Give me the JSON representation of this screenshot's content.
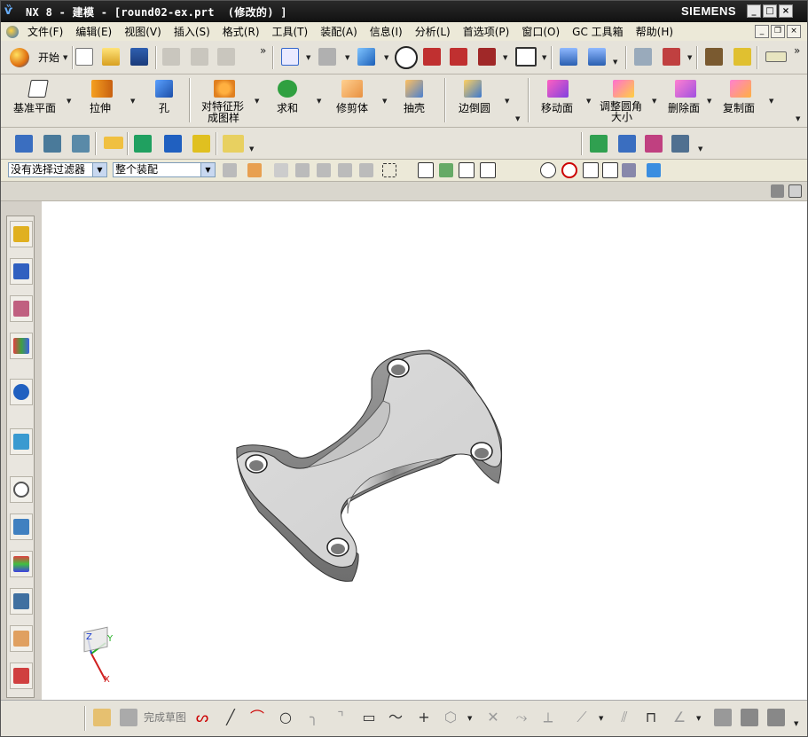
{
  "titlebar": {
    "text": "NX 8 - 建模 - [round02-ex.prt  (修改的) ]",
    "brand": "SIEMENS",
    "minimize": "_",
    "restore": "□",
    "close": "×"
  },
  "menubar": {
    "items": [
      "文件(F)",
      "编辑(E)",
      "视图(V)",
      "插入(S)",
      "格式(R)",
      "工具(T)",
      "装配(A)",
      "信息(I)",
      "分析(L)",
      "首选项(P)",
      "窗口(O)",
      "GC 工具箱",
      "帮助(H)"
    ]
  },
  "toolbar1": {
    "start_label": "开始",
    "overflow": "»"
  },
  "toolbar2": {
    "buttons": [
      {
        "label": "基准平面",
        "icon": "datum-plane-icon"
      },
      {
        "label": "拉伸",
        "icon": "extrude-icon"
      },
      {
        "label": "孔",
        "icon": "hole-icon"
      },
      {
        "label": "对特征形成图样",
        "line1": "对特征形",
        "line2": "成图样",
        "icon": "pattern-feature-icon"
      },
      {
        "label": "求和",
        "icon": "unite-icon"
      },
      {
        "label": "修剪体",
        "icon": "trim-body-icon"
      },
      {
        "label": "抽壳",
        "icon": "shell-icon"
      },
      {
        "label": "边倒圆",
        "icon": "edge-blend-icon"
      },
      {
        "label": "移动面",
        "icon": "move-face-icon"
      },
      {
        "label": "调整圆角大小",
        "line1": "调整圆角",
        "line2": "大小",
        "icon": "resize-blend-icon"
      },
      {
        "label": "删除面",
        "icon": "delete-face-icon"
      },
      {
        "label": "复制面",
        "icon": "copy-face-icon"
      }
    ]
  },
  "selectionbar": {
    "filter_value": "没有选择过滤器",
    "scope_value": "整个装配"
  },
  "bottombar": {
    "finish_sketch_label": "完成草图"
  },
  "triad": {
    "x": "X",
    "y": "Y",
    "z": "Z"
  },
  "colors": {
    "titlebar": "#1a1a1a",
    "toolbar": "#e6e3da",
    "viewport": "#ffffff",
    "part_fill": "#d8d8d8",
    "part_side": "#8a8a8a"
  }
}
